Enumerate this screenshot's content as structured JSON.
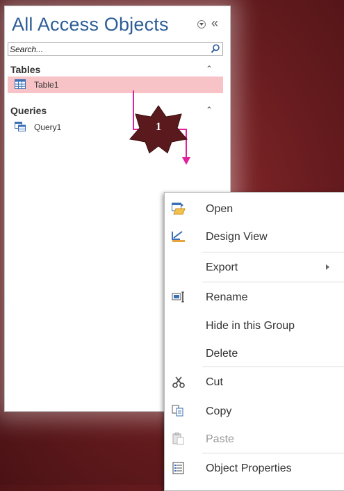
{
  "nav_pane": {
    "title": "All Access Objects",
    "search_placeholder": "Search...",
    "groups": [
      {
        "label": "Tables",
        "items": [
          {
            "label": "Table1",
            "selected": true
          }
        ]
      },
      {
        "label": "Queries",
        "items": [
          {
            "label": "Query1",
            "selected": false
          }
        ]
      }
    ]
  },
  "annotation": {
    "step_number": "1"
  },
  "context_menu": {
    "items": [
      {
        "label": "Open",
        "icon": "open-icon"
      },
      {
        "label": "Design View",
        "icon": "design-view-icon"
      },
      {
        "label": "Export",
        "icon": "",
        "submenu": true
      },
      {
        "label": "Rename",
        "icon": "rename-icon"
      },
      {
        "label": "Hide in this Group",
        "icon": ""
      },
      {
        "label": "Delete",
        "icon": ""
      },
      {
        "label": "Cut",
        "icon": "scissors-icon"
      },
      {
        "label": "Copy",
        "icon": "copy-icon"
      },
      {
        "label": "Paste",
        "icon": "paste-icon",
        "disabled": true
      },
      {
        "label": "Object Properties",
        "icon": "properties-icon"
      }
    ]
  },
  "colors": {
    "title_blue": "#2c5d96",
    "selection_pink": "#f7c3c6",
    "annotation_magenta": "#e0219e",
    "badge_maroon": "#5a1a1d"
  }
}
